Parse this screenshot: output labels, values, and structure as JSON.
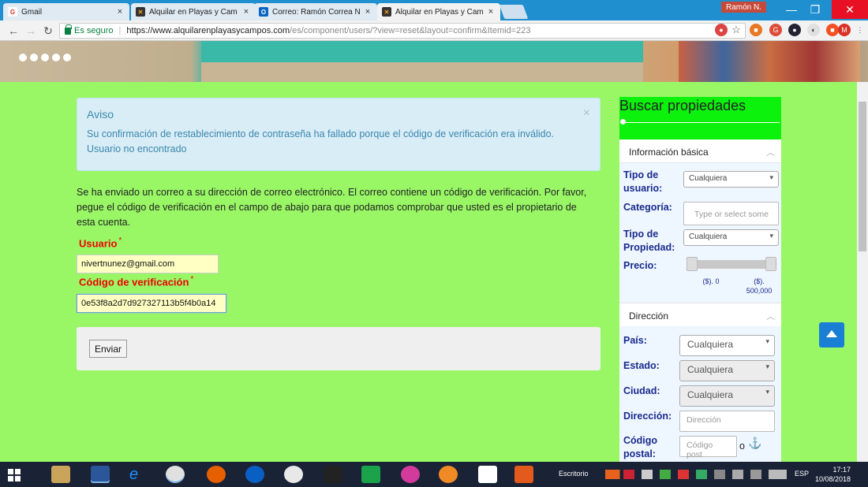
{
  "browser": {
    "tabs": [
      {
        "label": "Gmail",
        "icon": "gmail-icon",
        "close": "×"
      },
      {
        "label": "Alquilar en Playas y Cam",
        "icon": "site-icon",
        "close": "×"
      },
      {
        "label": "Correo: Ramón Correa N",
        "icon": "outlook-icon",
        "close": "×"
      },
      {
        "label": "Alquilar en Playas y Cam",
        "icon": "site-icon",
        "close": "×"
      }
    ],
    "profile_name": "Ramón N.",
    "secure_label": "Es seguro",
    "url_host": "https://www.alquilarenplayasycampos.com",
    "url_path": "/es/component/users/?view=reset&layout=confirm&Itemid=223"
  },
  "alert": {
    "title": "Aviso",
    "close": "×",
    "message_line1": "Su confirmación de restablecimiento de contraseña ha fallado porque el código de verificación era inválido.",
    "message_line2": "Usuario no encontrado"
  },
  "form": {
    "intro": "Se ha enviado un correo a su dirección de correo electrónico. El correo contiene un código de verificación. Por favor, pegue el código de verificación en el campo de abajo para que podamos comprobar que usted es el propietario de esta cuenta.",
    "username_label": "Usuario",
    "username_value": "nivertnunez@gmail.com",
    "code_label": "Código de verificación",
    "code_value": "0e53f8a2d7d927327113b5f4b0a14",
    "required_mark": "*",
    "submit_label": "Enviar"
  },
  "sidebar": {
    "title": "Buscar propiedades",
    "basic_section": "Información básica",
    "tipo_usuario_label": "Tipo de usuario:",
    "tipo_usuario_value": "Cualquiera",
    "categoria_label": "Categoría:",
    "categoria_placeholder": "Type or select some",
    "tipo_propiedad_label": "Tipo de Propiedad:",
    "tipo_propiedad_value": "Cualquiera",
    "precio_label": "Precio:",
    "precio_min": "($). 0",
    "precio_max_a": "($).",
    "precio_max_b": "500,000",
    "direccion_section": "Dirección",
    "pais_label": "País:",
    "pais_value": "Cualquiera",
    "estado_label": "Estado:",
    "estado_value": "Cualquiera",
    "ciudad_label": "Ciudad:",
    "ciudad_value": "Cualquiera",
    "direccion_label": "Dirección:",
    "direccion_placeholder": "Dirección",
    "codigo_label": "Código postal:",
    "codigo_placeholder": "Código post",
    "codigo_suffix": "o"
  },
  "taskbar": {
    "desktop_label": "Escritorio",
    "language": "ESP",
    "time": "17:17",
    "date": "10/08/2018"
  }
}
